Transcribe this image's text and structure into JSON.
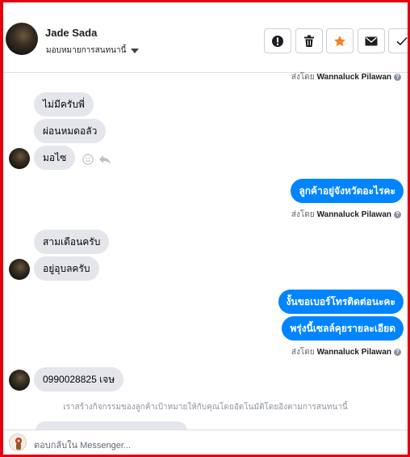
{
  "header": {
    "contact_name": "Jade Sada",
    "assignment_label": "มอบหมายการสนทนานี้",
    "actions": [
      {
        "icon": "alert-icon",
        "label": "!"
      },
      {
        "icon": "trash-icon"
      },
      {
        "icon": "star-icon",
        "color": "#f5821f"
      },
      {
        "icon": "mail-icon"
      },
      {
        "icon": "check-icon"
      }
    ]
  },
  "messages": {
    "sent_by_prefix": "ส่งโดย",
    "agent_name": "Wannaluck Pilawan",
    "m1": "ไม่มีครับพี่",
    "m2": "ผ่อนหมดอลัว",
    "m3": "มอไซ",
    "m4": "ลูกค้าอยู่จังหวัดอะไรคะ",
    "m5": "สามเดือนครับ",
    "m6": "อยู่อุบลครับ",
    "m7": "งั้นขอเบอร์โทรติดต่อนะคะ",
    "m8": "พรุ่งนี้เซลล์คุยรายละเอียด",
    "m9": "0990028825 เจษ"
  },
  "notice": "เราสร้างกิจกรรมของลูกค้าเป้าหมายให้กับคุณโดยอัตโนมัติโดยอิงตามการสนทนานี้",
  "composer": {
    "placeholder": "ตอบกลับใน Messenger..."
  },
  "colors": {
    "outgoing": "#0084ff",
    "incoming": "#e4e6eb",
    "frame": "#e0000e",
    "star": "#f5821f"
  }
}
